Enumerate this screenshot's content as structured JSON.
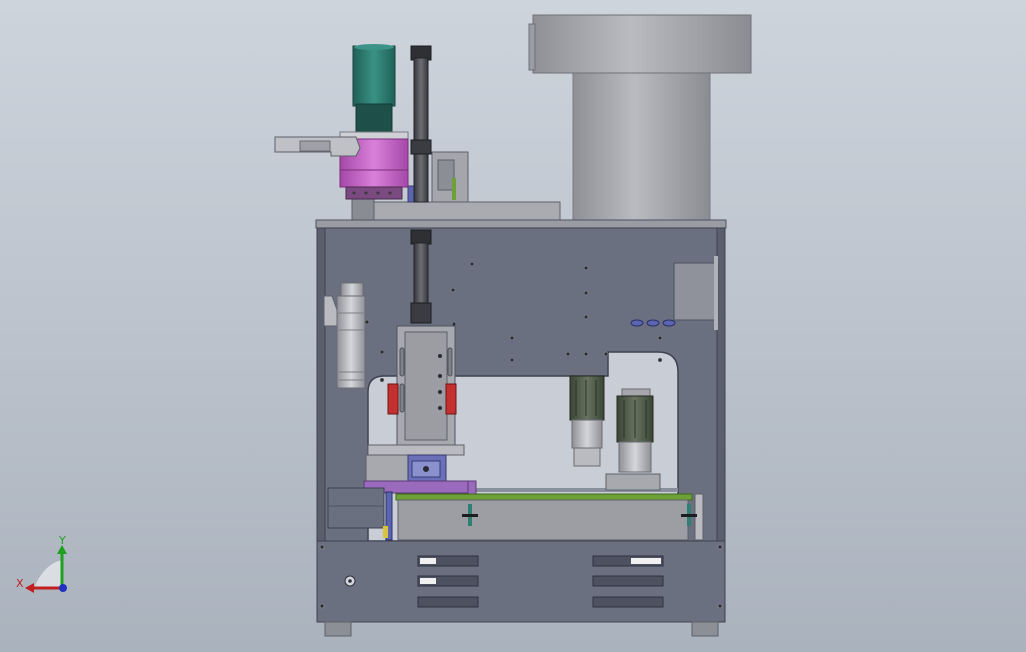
{
  "viewport": {
    "background_top": "#ced4dc",
    "background_bottom": "#aab2bd"
  },
  "colors": {
    "frame": "#6b7080",
    "frame_dark": "#4d5261",
    "frame_light": "#8a8f9e",
    "steel": "#9a9ca3",
    "steel_light": "#b8babf",
    "hopper": "#a3a5aa",
    "motor_teal": "#2f7f73",
    "motor_teal_dark": "#1e5c53",
    "gearbox_magenta": "#c25fc4",
    "rod_dark": "#4a4c52",
    "servo_olive": "#4d5a47",
    "conveyor_green": "#6da037",
    "bracket_purple": "#9a6bbd",
    "clamp_red": "#c23030",
    "slot_white": "#f0f0f0",
    "foot": "#8c8f95"
  },
  "triad": {
    "x_label": "X",
    "y_label": "Y",
    "x_color": "#c02020",
    "y_color": "#20a020",
    "z_color": "#2030c0"
  }
}
